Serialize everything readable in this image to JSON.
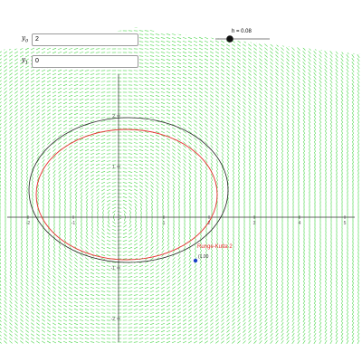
{
  "inputs": [
    {
      "label": "y",
      "sub": "0",
      "value": "2"
    },
    {
      "label": "y",
      "sub": "1",
      "value": "0"
    }
  ],
  "slider": {
    "label": "h = 0.08",
    "value": 0.08,
    "min": 0,
    "max": 0.3
  },
  "axes": {
    "x_ticks": [
      "-2",
      "-1",
      "1",
      "2",
      "3",
      "4",
      "5"
    ],
    "y_ticks": [
      "2",
      "1",
      "-1",
      "-2"
    ]
  },
  "curves": {
    "exact": {
      "name": "",
      "color": "#222222"
    },
    "runge_kutta": {
      "name": "Runge-Kutta 2",
      "color": "#e83030"
    }
  },
  "point_label": "(1.00",
  "colors": {
    "field": "#4cd64c",
    "axis": "#333333",
    "point": "#1a3ec8"
  }
}
